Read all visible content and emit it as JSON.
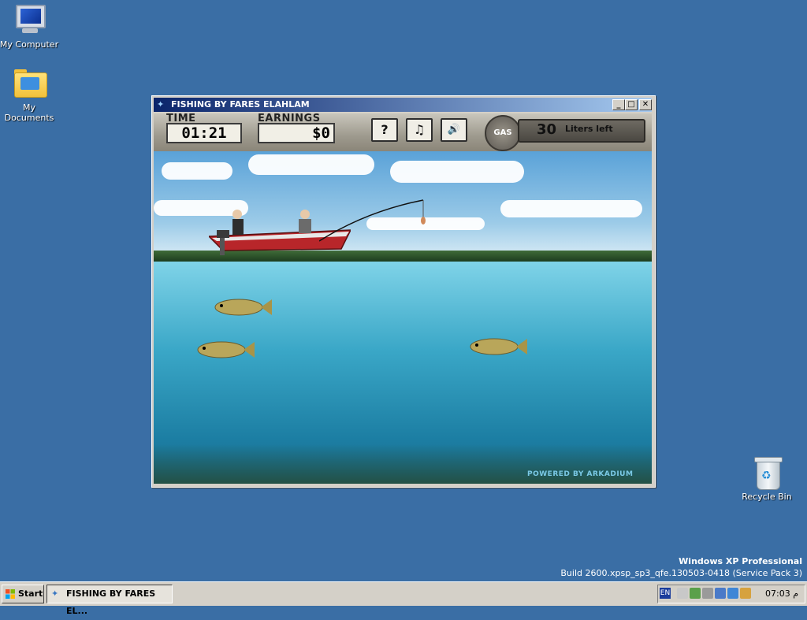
{
  "desktop": {
    "icons": [
      {
        "label": "My Computer"
      },
      {
        "label": "My Documents"
      },
      {
        "label": "Recycle Bin"
      }
    ],
    "watermark": {
      "title": "Windows XP Professional",
      "build": "Build 2600.xpsp_sp3_qfe.130503-0418 (Service Pack 3)"
    }
  },
  "window": {
    "title": "FISHING BY FARES ELAHLAM",
    "controls": {
      "minimize": "_",
      "maximize": "□",
      "close": "✕"
    }
  },
  "game": {
    "time_label": "TIME",
    "time_value": "01:21",
    "earnings_label": "EARNINGS",
    "earnings_value": "$0",
    "help_label": "?",
    "music_label": "♫",
    "sound_label": "🔊",
    "gas_label": "GAS",
    "gas_value": "30",
    "gas_unit": "Liters left",
    "powered_by": "POWERED BY ARKADIUM"
  },
  "taskbar": {
    "start_label": "Start",
    "task_item_label": "FISHING BY FARES EL...",
    "lang": "EN",
    "clock": "07:03 م"
  }
}
